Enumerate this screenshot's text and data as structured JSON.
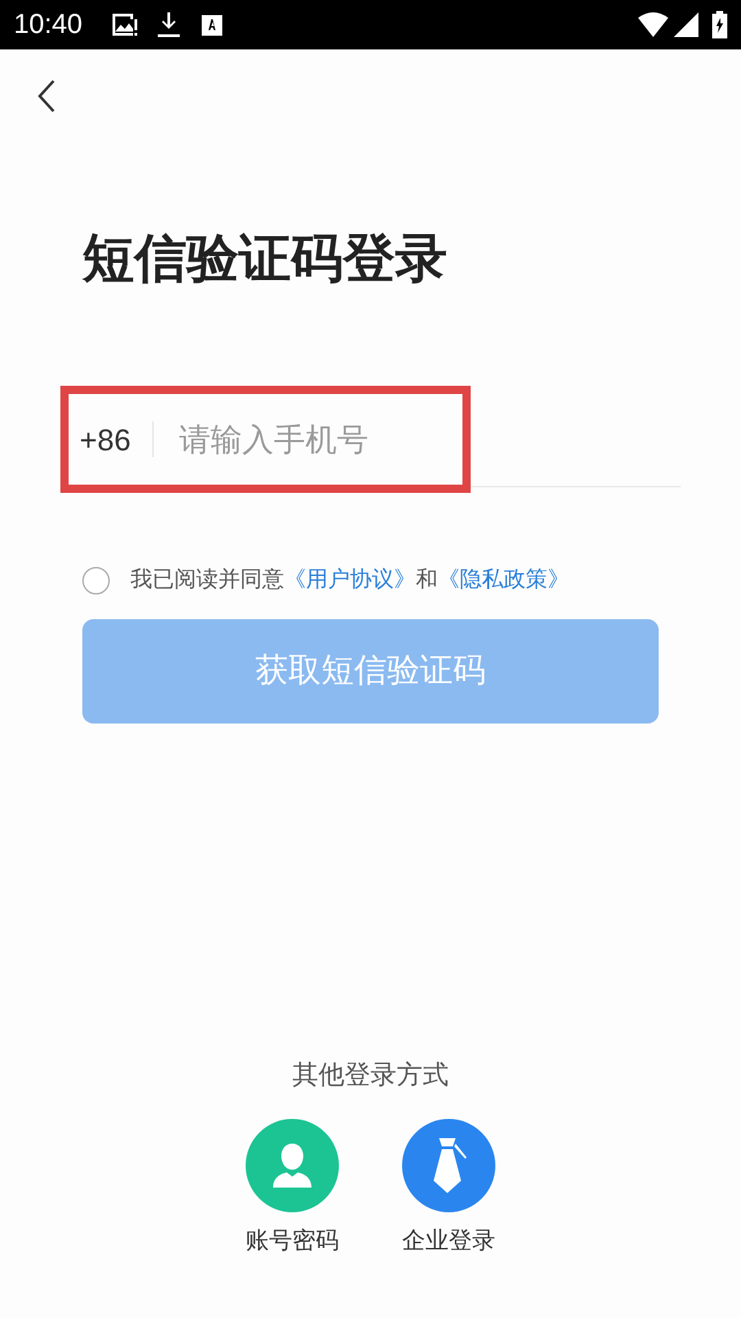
{
  "status_bar": {
    "time": "10:40"
  },
  "title": "短信验证码登录",
  "phone": {
    "country_code": "+86",
    "placeholder": "请输入手机号",
    "highlighted": true
  },
  "agreement": {
    "checked": false,
    "text_before": "我已阅读并同意",
    "link_1": "《用户协议》",
    "joiner": "和",
    "link_2": "《隐私政策》"
  },
  "submit_button": {
    "label": "获取短信验证码",
    "disabled": true
  },
  "other_methods": {
    "heading": "其他登录方式",
    "options": [
      {
        "kind": "account",
        "label": "账号密码",
        "color": "#1cc494"
      },
      {
        "kind": "enterprise",
        "label": "企业登录",
        "color": "#2a86ee"
      }
    ]
  }
}
